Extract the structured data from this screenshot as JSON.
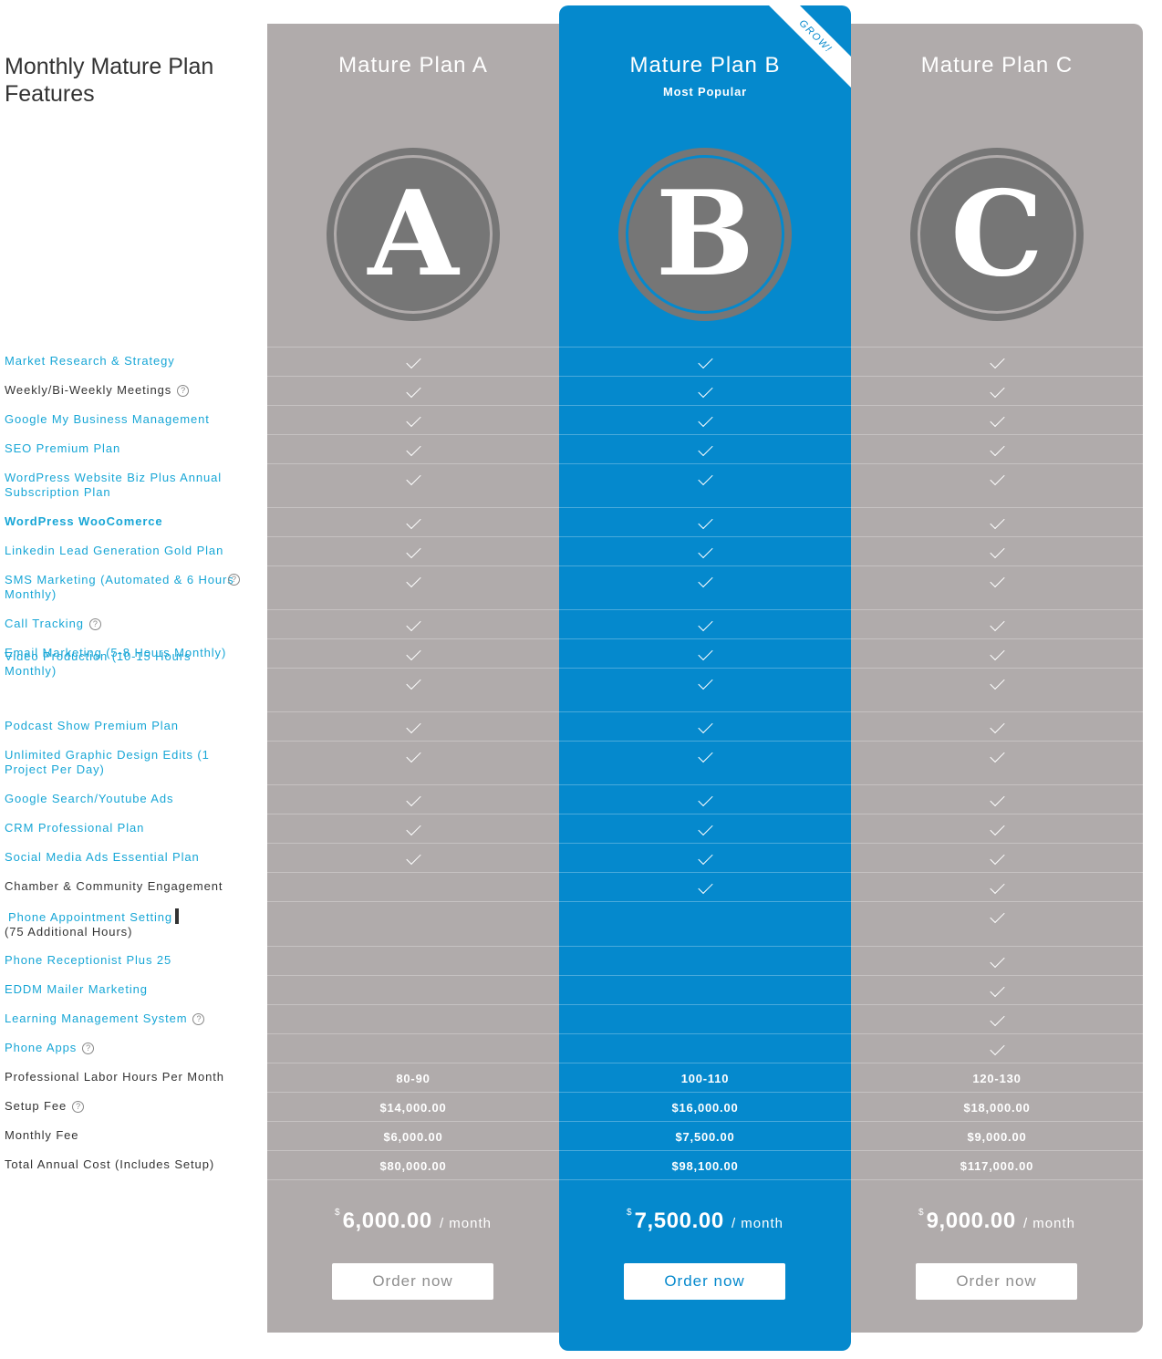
{
  "features_title": "Monthly Mature Plan Features",
  "features": [
    {
      "label": "Market Research & Strategy",
      "style": "link",
      "help": false
    },
    {
      "label": "Weekly/Bi-Weekly Meetings",
      "style": "dark",
      "help": true
    },
    {
      "label": "Google My Business Management",
      "style": "link",
      "help": false
    },
    {
      "label": "SEO Premium Plan",
      "style": "link",
      "help": false
    },
    {
      "label": "WordPress Website Biz Plus Annual Subscription Plan",
      "style": "link",
      "help": false
    },
    {
      "label": "WordPress WooComerce",
      "style": "link-bold",
      "help": false
    },
    {
      "label": "Linkedin Lead Generation Gold Plan",
      "style": "link",
      "help": false
    },
    {
      "label": "SMS Marketing (Automated & 6 Hours Monthly)",
      "style": "link",
      "help": true
    },
    {
      "label": "Call Tracking",
      "style": "link",
      "help": true
    },
    {
      "label": "Email Marketing (5-8 Hours Monthly)",
      "style": "link",
      "help": false
    },
    {
      "label": "Video Production (10-15 Hours Monthly)",
      "style": "link",
      "help": false
    },
    {
      "label": "Podcast Show Premium Plan",
      "style": "link",
      "help": false
    },
    {
      "label": "Unlimited Graphic Design Edits (1 Project Per Day)",
      "style": "link",
      "help": false
    },
    {
      "label": "Google Search/Youtube Ads",
      "style": "link",
      "help": false
    },
    {
      "label": "CRM Professional Plan",
      "style": "link",
      "help": false
    },
    {
      "label": "Social Media Ads Essential Plan",
      "style": "link",
      "help": false
    },
    {
      "label": "Chamber & Community Engagement",
      "style": "dark",
      "help": false
    },
    {
      "label": "Phone Appointment Setting",
      "label_extra": "(75 Additional Hours)",
      "style": "link",
      "help": false
    },
    {
      "label": "Phone Receptionist Plus 25",
      "style": "link",
      "help": false
    },
    {
      "label": "EDDM Mailer Marketing",
      "style": "link",
      "help": false
    },
    {
      "label": "Learning Management System",
      "style": "link",
      "help": true
    },
    {
      "label": "Phone Apps",
      "style": "link",
      "help": true
    },
    {
      "label": "Professional Labor Hours Per Month",
      "style": "dark",
      "help": false
    },
    {
      "label": "Setup Fee",
      "style": "dark",
      "help": true
    },
    {
      "label": "Monthly Fee",
      "style": "dark",
      "help": false
    },
    {
      "label": "Total Annual Cost (Includes Setup)",
      "style": "dark",
      "help": false
    }
  ],
  "plans": [
    {
      "name": "Mature Plan A",
      "subtitle": "",
      "ribbon": "",
      "badge_letter": "A",
      "checks": [
        true,
        true,
        true,
        true,
        true,
        true,
        true,
        true,
        true,
        true,
        true,
        true,
        true,
        true,
        true,
        true,
        false,
        false,
        false,
        false,
        false,
        false
      ],
      "labor_hours": "80-90",
      "setup_fee": "$14,000.00",
      "monthly_fee": "$6,000.00",
      "annual_cost": "$80,000.00",
      "price_currency": "$",
      "price_amount": "6,000.00",
      "price_period": "/  month",
      "order_label": "Order now"
    },
    {
      "name": "Mature Plan B",
      "subtitle": "Most Popular",
      "ribbon": "GROW!",
      "badge_letter": "B",
      "checks": [
        true,
        true,
        true,
        true,
        true,
        true,
        true,
        true,
        true,
        true,
        true,
        true,
        true,
        true,
        true,
        true,
        true,
        false,
        false,
        false,
        false,
        false
      ],
      "labor_hours": "100-110",
      "setup_fee": "$16,000.00",
      "monthly_fee": "$7,500.00",
      "annual_cost": "$98,100.00",
      "price_currency": "$",
      "price_amount": "7,500.00",
      "price_period": "/  month",
      "order_label": "Order now"
    },
    {
      "name": "Mature Plan C",
      "subtitle": "",
      "ribbon": "",
      "badge_letter": "C",
      "checks": [
        true,
        true,
        true,
        true,
        true,
        true,
        true,
        true,
        true,
        true,
        true,
        true,
        true,
        true,
        true,
        true,
        true,
        true,
        true,
        true,
        true,
        true
      ],
      "labor_hours": "120-130",
      "setup_fee": "$18,000.00",
      "monthly_fee": "$9,000.00",
      "annual_cost": "$117,000.00",
      "price_currency": "$",
      "price_amount": "9,000.00",
      "price_period": "/  month",
      "order_label": "Order now"
    }
  ],
  "colors": {
    "featured": "#0589cd",
    "standard": "#b0abab",
    "badge": "#767676",
    "link": "#17a6d6"
  },
  "icons": {
    "check": "check-icon",
    "help": "help-circle-icon"
  }
}
